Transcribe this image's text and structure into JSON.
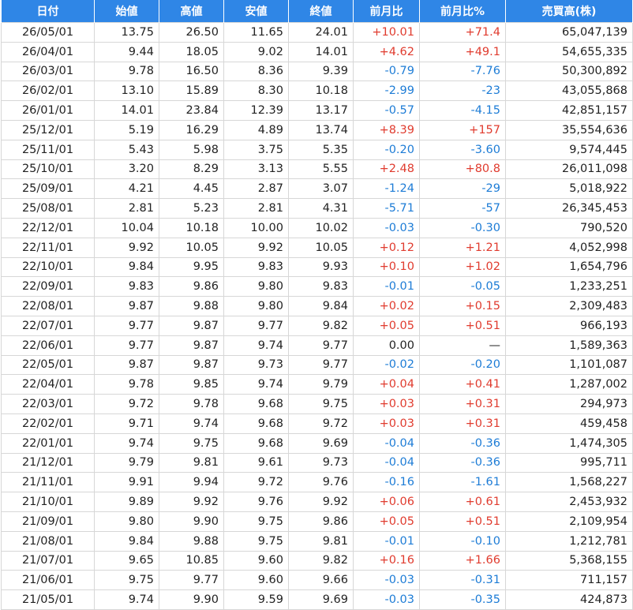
{
  "table": {
    "headers": [
      "日付",
      "始値",
      "高値",
      "安値",
      "終値",
      "前月比",
      "前月比%",
      "売買高(株)"
    ],
    "rows": [
      [
        "26/05/01",
        "13.75",
        "26.50",
        "11.65",
        "24.01",
        "+10.01",
        "+71.4",
        "65,047,139"
      ],
      [
        "26/04/01",
        "9.44",
        "18.05",
        "9.02",
        "14.01",
        "+4.62",
        "+49.1",
        "54,655,335"
      ],
      [
        "26/03/01",
        "9.78",
        "16.50",
        "8.36",
        "9.39",
        "-0.79",
        "-7.76",
        "50,300,892"
      ],
      [
        "26/02/01",
        "13.10",
        "15.89",
        "8.30",
        "10.18",
        "-2.99",
        "-23",
        "43,055,868"
      ],
      [
        "26/01/01",
        "14.01",
        "23.84",
        "12.39",
        "13.17",
        "-0.57",
        "-4.15",
        "42,851,157"
      ],
      [
        "25/12/01",
        "5.19",
        "16.29",
        "4.89",
        "13.74",
        "+8.39",
        "+157",
        "35,554,636"
      ],
      [
        "25/11/01",
        "5.43",
        "5.98",
        "3.75",
        "5.35",
        "-0.20",
        "-3.60",
        "9,574,445"
      ],
      [
        "25/10/01",
        "3.20",
        "8.29",
        "3.13",
        "5.55",
        "+2.48",
        "+80.8",
        "26,011,098"
      ],
      [
        "25/09/01",
        "4.21",
        "4.45",
        "2.87",
        "3.07",
        "-1.24",
        "-29",
        "5,018,922"
      ],
      [
        "25/08/01",
        "2.81",
        "5.23",
        "2.81",
        "4.31",
        "-5.71",
        "-57",
        "26,345,453"
      ],
      [
        "22/12/01",
        "10.04",
        "10.18",
        "10.00",
        "10.02",
        "-0.03",
        "-0.30",
        "790,520"
      ],
      [
        "22/11/01",
        "9.92",
        "10.05",
        "9.92",
        "10.05",
        "+0.12",
        "+1.21",
        "4,052,998"
      ],
      [
        "22/10/01",
        "9.84",
        "9.95",
        "9.83",
        "9.93",
        "+0.10",
        "+1.02",
        "1,654,796"
      ],
      [
        "22/09/01",
        "9.83",
        "9.86",
        "9.80",
        "9.83",
        "-0.01",
        "-0.05",
        "1,233,251"
      ],
      [
        "22/08/01",
        "9.87",
        "9.88",
        "9.80",
        "9.84",
        "+0.02",
        "+0.15",
        "2,309,483"
      ],
      [
        "22/07/01",
        "9.77",
        "9.87",
        "9.77",
        "9.82",
        "+0.05",
        "+0.51",
        "966,193"
      ],
      [
        "22/06/01",
        "9.77",
        "9.87",
        "9.74",
        "9.77",
        "0.00",
        "—",
        "1,589,363"
      ],
      [
        "22/05/01",
        "9.87",
        "9.87",
        "9.73",
        "9.77",
        "-0.02",
        "-0.20",
        "1,101,087"
      ],
      [
        "22/04/01",
        "9.78",
        "9.85",
        "9.74",
        "9.79",
        "+0.04",
        "+0.41",
        "1,287,002"
      ],
      [
        "22/03/01",
        "9.72",
        "9.78",
        "9.68",
        "9.75",
        "+0.03",
        "+0.31",
        "294,973"
      ],
      [
        "22/02/01",
        "9.71",
        "9.74",
        "9.68",
        "9.72",
        "+0.03",
        "+0.31",
        "459,458"
      ],
      [
        "22/01/01",
        "9.74",
        "9.75",
        "9.68",
        "9.69",
        "-0.04",
        "-0.36",
        "1,474,305"
      ],
      [
        "21/12/01",
        "9.79",
        "9.81",
        "9.61",
        "9.73",
        "-0.04",
        "-0.36",
        "995,711"
      ],
      [
        "21/11/01",
        "9.91",
        "9.94",
        "9.72",
        "9.76",
        "-0.16",
        "-1.61",
        "1,568,227"
      ],
      [
        "21/10/01",
        "9.89",
        "9.92",
        "9.76",
        "9.92",
        "+0.06",
        "+0.61",
        "2,453,932"
      ],
      [
        "21/09/01",
        "9.80",
        "9.90",
        "9.75",
        "9.86",
        "+0.05",
        "+0.51",
        "2,109,954"
      ],
      [
        "21/08/01",
        "9.84",
        "9.88",
        "9.75",
        "9.81",
        "-0.01",
        "-0.10",
        "1,212,781"
      ],
      [
        "21/07/01",
        "9.65",
        "10.85",
        "9.60",
        "9.82",
        "+0.16",
        "+1.66",
        "5,368,155"
      ],
      [
        "21/06/01",
        "9.75",
        "9.77",
        "9.60",
        "9.66",
        "-0.03",
        "-0.31",
        "711,157"
      ],
      [
        "21/05/01",
        "9.74",
        "9.90",
        "9.59",
        "9.69",
        "-0.03",
        "-0.35",
        "424,873"
      ]
    ]
  },
  "colors": {
    "header_bg": "#2f86e6",
    "positive": "#e03b2e",
    "negative": "#1d7cd6"
  }
}
